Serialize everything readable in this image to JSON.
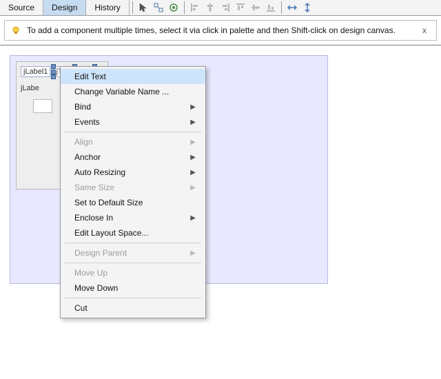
{
  "tabs": {
    "source": "Source",
    "design": "Design",
    "history": "History",
    "active": "design"
  },
  "hint": {
    "text": "To add a component multiple times, select it via click in palette and then Shift-click on design canvas.",
    "close": "x"
  },
  "form": {
    "label1": "jLabel1",
    "textfield1": "jTextField1",
    "label2": "jLabe"
  },
  "context_menu": {
    "edit_text": "Edit Text",
    "change_var": "Change Variable Name ...",
    "bind": "Bind",
    "events": "Events",
    "align": "Align",
    "anchor": "Anchor",
    "auto_resizing": "Auto Resizing",
    "same_size": "Same Size",
    "set_default": "Set to Default Size",
    "enclose_in": "Enclose In",
    "edit_layout": "Edit Layout Space...",
    "design_parent": "Design Parent",
    "move_up": "Move Up",
    "move_down": "Move Down",
    "cut": "Cut"
  },
  "icons": {
    "select": "select-tool",
    "connect": "connect-tool",
    "preview": "preview-tool",
    "al_left": "align-left",
    "al_hc": "align-hcenter",
    "al_right": "align-right",
    "al_top": "align-top",
    "al_vc": "align-vcenter",
    "al_bot": "align-bottom",
    "res_h": "resize-horizontal",
    "res_v": "resize-vertical"
  }
}
